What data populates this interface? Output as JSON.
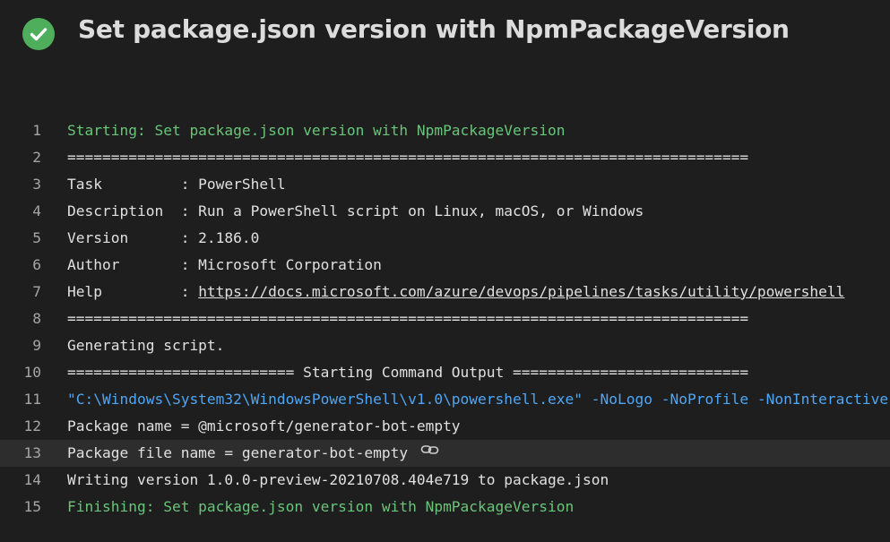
{
  "header": {
    "title": "Set package.json version with NpmPackageVersion",
    "status_icon": "success-check-icon",
    "status_color": "#4fae5c"
  },
  "log": {
    "lines": [
      {
        "number": "1",
        "text": "Starting: Set package.json version with NpmPackageVersion"
      },
      {
        "number": "2",
        "text": "=============================================================================="
      },
      {
        "number": "3",
        "text": "Task         : PowerShell"
      },
      {
        "number": "4",
        "text": "Description  : Run a PowerShell script on Linux, macOS, or Windows"
      },
      {
        "number": "5",
        "text": "Version      : 2.186.0"
      },
      {
        "number": "6",
        "text": "Author       : Microsoft Corporation"
      },
      {
        "number": "7",
        "label": "Help         : ",
        "link": "https://docs.microsoft.com/azure/devops/pipelines/tasks/utility/powershell"
      },
      {
        "number": "8",
        "text": "=============================================================================="
      },
      {
        "number": "9",
        "text": "Generating script."
      },
      {
        "number": "10",
        "text": "========================== Starting Command Output ==========================="
      },
      {
        "number": "11",
        "path": "\"C:\\Windows\\System32\\WindowsPowerShell\\v1.0\\powershell.exe\"",
        "args": " -NoLogo -NoProfile -NonInteractive -ExecutionPolicy Unrestricted -Command"
      },
      {
        "number": "12",
        "text": "Package name = @microsoft/generator-bot-empty"
      },
      {
        "number": "13",
        "text": "Package file name = generator-bot-empty",
        "icon": "link-icon"
      },
      {
        "number": "14",
        "text": "Writing version 1.0.0-preview-20210708.404e719 to package.json"
      },
      {
        "number": "15",
        "text": "Finishing: Set package.json version with NpmPackageVersion"
      }
    ]
  },
  "colors": {
    "background": "#1e1e1e",
    "section_text": "#69c57a",
    "command_text": "#4fa6f5",
    "hover_row": "#2d2d2d"
  }
}
